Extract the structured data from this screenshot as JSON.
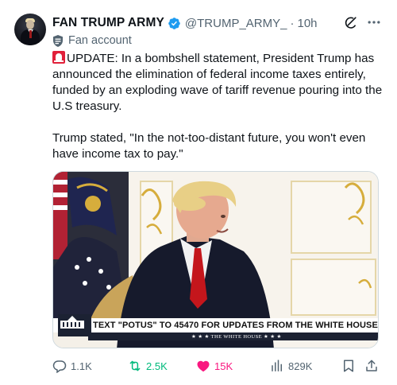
{
  "author": {
    "display_name": "FAN TRUMP ARMY",
    "handle": "@TRUMP_ARMY_",
    "separator": "·",
    "time": "10h",
    "badge": "Fan account"
  },
  "body": {
    "paragraph1_text": "UPDATE: In a bombshell statement, President Trump has announced the elimination of federal income taxes entirely, funded by an exploding wave of tariff revenue pouring into the U.S treasury.",
    "paragraph2_text": "Trump stated, \"In the not-too-distant future, you won't even have income tax to pay.\""
  },
  "media": {
    "chyron_text": "TEXT \"POTUS\" TO 45470 FOR UPDATES FROM THE WHITE HOUSE",
    "chyron_sub": "★ ★ ★  THE WHITE HOUSE  ★ ★ ★",
    "logo_text": "THE WHITE HOUSE"
  },
  "actions": {
    "replies": "1.1K",
    "reposts": "2.5K",
    "likes": "15K",
    "views": "829K"
  },
  "colors": {
    "verified": "#1d9bf0",
    "repost": "#00ba7c",
    "like": "#f91880",
    "muted": "#536471",
    "alert": "#e1203a"
  },
  "icons": {
    "verified": "verified-badge-icon",
    "grok": "grok-icon",
    "more": "more-icon",
    "fan": "fan-account-icon",
    "reply": "reply-icon",
    "repost": "repost-icon",
    "like": "heart-icon",
    "views": "views-icon",
    "bookmark": "bookmark-icon",
    "share": "share-icon"
  }
}
